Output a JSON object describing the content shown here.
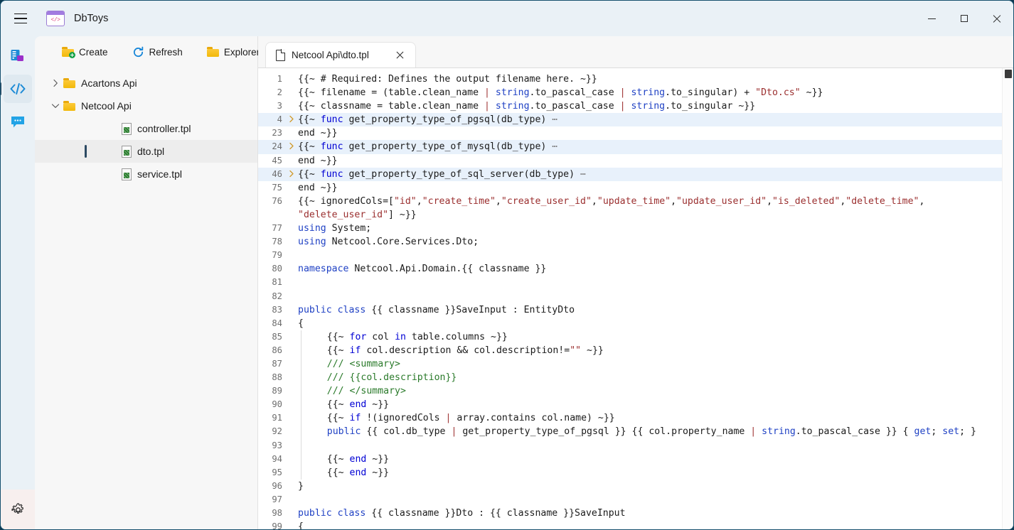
{
  "window": {
    "title": "DbToys",
    "logo_icon": "code-brackets-logo",
    "menu_icon": "hamburger-icon",
    "controls": {
      "minimize": "minimize-icon",
      "maximize": "maximize-icon",
      "close": "close-icon"
    }
  },
  "activity_bar": {
    "items": [
      {
        "name": "database-icon",
        "label": "Database",
        "active": false
      },
      {
        "name": "code-icon",
        "label": "Templates",
        "active": true
      },
      {
        "name": "chat-icon",
        "label": "Chat",
        "active": false
      }
    ],
    "settings": {
      "name": "gear-icon",
      "label": "Settings"
    }
  },
  "explorer": {
    "toolbar": [
      {
        "label": "Create",
        "icon": "new-folder-icon"
      },
      {
        "label": "Refresh",
        "icon": "refresh-icon"
      },
      {
        "label": "Explorer",
        "icon": "folder-icon"
      }
    ],
    "tree": [
      {
        "label": "Acartons Api",
        "type": "folder",
        "expanded": false,
        "depth": 0,
        "selected": false
      },
      {
        "label": "Netcool Api",
        "type": "folder",
        "expanded": true,
        "depth": 0,
        "selected": false
      },
      {
        "label": "controller.tpl",
        "type": "file",
        "depth": 1,
        "selected": false
      },
      {
        "label": "dto.tpl",
        "type": "file",
        "depth": 1,
        "selected": true
      },
      {
        "label": "service.tpl",
        "type": "file",
        "depth": 1,
        "selected": false
      }
    ]
  },
  "editor": {
    "tabs": [
      {
        "label": "Netcool Api\\dto.tpl",
        "icon": "file-icon",
        "close_icon": "close-icon",
        "active": true
      }
    ],
    "lines": [
      {
        "num": "1",
        "fold": "",
        "hl": false,
        "guide": false,
        "tokens": [
          {
            "t": "{{~ # Required: Defines the output filename here. ~}}",
            "c": "plain"
          }
        ]
      },
      {
        "num": "2",
        "fold": "",
        "hl": false,
        "guide": false,
        "tokens": [
          {
            "t": "{{~ filename = (table.clean_name ",
            "c": "plain"
          },
          {
            "t": "| ",
            "c": "pipe"
          },
          {
            "t": "string",
            "c": "kw2"
          },
          {
            "t": ".to_pascal_case ",
            "c": "plain"
          },
          {
            "t": "| ",
            "c": "pipe"
          },
          {
            "t": "string",
            "c": "kw2"
          },
          {
            "t": ".to_singular) + ",
            "c": "plain"
          },
          {
            "t": "\"Dto.cs\"",
            "c": "str"
          },
          {
            "t": " ~}}",
            "c": "plain"
          }
        ]
      },
      {
        "num": "3",
        "fold": "",
        "hl": false,
        "guide": false,
        "tokens": [
          {
            "t": "{{~ classname = table.clean_name ",
            "c": "plain"
          },
          {
            "t": "| ",
            "c": "pipe"
          },
          {
            "t": "string",
            "c": "kw2"
          },
          {
            "t": ".to_pascal_case ",
            "c": "plain"
          },
          {
            "t": "| ",
            "c": "pipe"
          },
          {
            "t": "string",
            "c": "kw2"
          },
          {
            "t": ".to_singular ~}}",
            "c": "plain"
          }
        ]
      },
      {
        "num": "4",
        "fold": ">",
        "hl": true,
        "guide": false,
        "tokens": [
          {
            "t": "{{~ ",
            "c": "plain"
          },
          {
            "t": "func",
            "c": "kw"
          },
          {
            "t": " get_property_type_of_pgsql(db_type)",
            "c": "plain"
          },
          {
            "t": " ⋯",
            "c": "ell"
          }
        ]
      },
      {
        "num": "23",
        "fold": "",
        "hl": false,
        "guide": false,
        "tokens": [
          {
            "t": "end ~}}",
            "c": "plain"
          }
        ]
      },
      {
        "num": "24",
        "fold": ">",
        "hl": true,
        "guide": false,
        "tokens": [
          {
            "t": "{{~ ",
            "c": "plain"
          },
          {
            "t": "func",
            "c": "kw"
          },
          {
            "t": " get_property_type_of_mysql(db_type)",
            "c": "plain"
          },
          {
            "t": " ⋯",
            "c": "ell"
          }
        ]
      },
      {
        "num": "45",
        "fold": "",
        "hl": false,
        "guide": false,
        "tokens": [
          {
            "t": "end ~}}",
            "c": "plain"
          }
        ]
      },
      {
        "num": "46",
        "fold": ">",
        "hl": true,
        "guide": false,
        "tokens": [
          {
            "t": "{{~ ",
            "c": "plain"
          },
          {
            "t": "func",
            "c": "kw"
          },
          {
            "t": " get_property_type_of_sql_server(db_type)",
            "c": "plain"
          },
          {
            "t": " ⋯",
            "c": "ell"
          }
        ]
      },
      {
        "num": "75",
        "fold": "",
        "hl": false,
        "guide": false,
        "tokens": [
          {
            "t": "end ~}}",
            "c": "plain"
          }
        ]
      },
      {
        "num": "76",
        "fold": "",
        "hl": false,
        "guide": false,
        "tokens": [
          {
            "t": "{{~ ignoredCols=[",
            "c": "plain"
          },
          {
            "t": "\"id\"",
            "c": "str"
          },
          {
            "t": ",",
            "c": "plain"
          },
          {
            "t": "\"create_time\"",
            "c": "str"
          },
          {
            "t": ",",
            "c": "plain"
          },
          {
            "t": "\"create_user_id\"",
            "c": "str"
          },
          {
            "t": ",",
            "c": "plain"
          },
          {
            "t": "\"update_time\"",
            "c": "str"
          },
          {
            "t": ",",
            "c": "plain"
          },
          {
            "t": "\"update_user_id\"",
            "c": "str"
          },
          {
            "t": ",",
            "c": "plain"
          },
          {
            "t": "\"is_deleted\"",
            "c": "str"
          },
          {
            "t": ",",
            "c": "plain"
          },
          {
            "t": "\"delete_time\"",
            "c": "str"
          },
          {
            "t": ",\n",
            "c": "plain"
          },
          {
            "t": "\"delete_user_id\"",
            "c": "str"
          },
          {
            "t": "] ~}}",
            "c": "plain"
          }
        ]
      },
      {
        "num": "77",
        "fold": "",
        "hl": false,
        "guide": false,
        "tokens": [
          {
            "t": "using",
            "c": "kw2"
          },
          {
            "t": " System;",
            "c": "plain"
          }
        ]
      },
      {
        "num": "78",
        "fold": "",
        "hl": false,
        "guide": false,
        "tokens": [
          {
            "t": "using",
            "c": "kw2"
          },
          {
            "t": " Netcool.Core.Services.Dto;",
            "c": "plain"
          }
        ]
      },
      {
        "num": "79",
        "fold": "",
        "hl": false,
        "guide": false,
        "tokens": []
      },
      {
        "num": "80",
        "fold": "",
        "hl": false,
        "guide": false,
        "tokens": [
          {
            "t": "namespace",
            "c": "kw2"
          },
          {
            "t": " Netcool.Api.Domain.{{ classname }}",
            "c": "plain"
          }
        ]
      },
      {
        "num": "81",
        "fold": "",
        "hl": false,
        "guide": false,
        "tokens": []
      },
      {
        "num": "82",
        "fold": "",
        "hl": false,
        "guide": false,
        "tokens": []
      },
      {
        "num": "83",
        "fold": "",
        "hl": false,
        "guide": false,
        "tokens": [
          {
            "t": "public",
            "c": "kw2"
          },
          {
            "t": " ",
            "c": "plain"
          },
          {
            "t": "class",
            "c": "kw2"
          },
          {
            "t": " {{ classname }}SaveInput : EntityDto",
            "c": "plain"
          }
        ]
      },
      {
        "num": "84",
        "fold": "",
        "hl": false,
        "guide": false,
        "tokens": [
          {
            "t": "{",
            "c": "plain"
          }
        ]
      },
      {
        "num": "85",
        "fold": "",
        "hl": false,
        "guide": true,
        "tokens": [
          {
            "t": "    {{~ ",
            "c": "plain"
          },
          {
            "t": "for",
            "c": "kw"
          },
          {
            "t": " col ",
            "c": "plain"
          },
          {
            "t": "in",
            "c": "kw"
          },
          {
            "t": " table.columns ~}}",
            "c": "plain"
          }
        ]
      },
      {
        "num": "86",
        "fold": "",
        "hl": false,
        "guide": true,
        "tokens": [
          {
            "t": "    {{~ ",
            "c": "plain"
          },
          {
            "t": "if",
            "c": "kw"
          },
          {
            "t": " col.description && col.description!=",
            "c": "plain"
          },
          {
            "t": "\"\"",
            "c": "str"
          },
          {
            "t": " ~}}",
            "c": "plain"
          }
        ]
      },
      {
        "num": "87",
        "fold": "",
        "hl": false,
        "guide": true,
        "tokens": [
          {
            "t": "    /// <summary>",
            "c": "cmt"
          }
        ]
      },
      {
        "num": "88",
        "fold": "",
        "hl": false,
        "guide": true,
        "tokens": [
          {
            "t": "    /// {{col.description}}",
            "c": "cmt"
          }
        ]
      },
      {
        "num": "89",
        "fold": "",
        "hl": false,
        "guide": true,
        "tokens": [
          {
            "t": "    /// </summary>",
            "c": "cmt"
          }
        ]
      },
      {
        "num": "90",
        "fold": "",
        "hl": false,
        "guide": true,
        "tokens": [
          {
            "t": "    {{~ ",
            "c": "plain"
          },
          {
            "t": "end",
            "c": "kw"
          },
          {
            "t": " ~}}",
            "c": "plain"
          }
        ]
      },
      {
        "num": "91",
        "fold": "",
        "hl": false,
        "guide": true,
        "tokens": [
          {
            "t": "    {{~ ",
            "c": "plain"
          },
          {
            "t": "if",
            "c": "kw"
          },
          {
            "t": " !(ignoredCols ",
            "c": "plain"
          },
          {
            "t": "| ",
            "c": "pipe"
          },
          {
            "t": "array",
            "c": "plain"
          },
          {
            "t": ".contains col.name) ~}}",
            "c": "plain"
          }
        ]
      },
      {
        "num": "92",
        "fold": "",
        "hl": false,
        "guide": true,
        "tokens": [
          {
            "t": "    ",
            "c": "plain"
          },
          {
            "t": "public",
            "c": "kw2"
          },
          {
            "t": " {{ col.db_type ",
            "c": "plain"
          },
          {
            "t": "| ",
            "c": "pipe"
          },
          {
            "t": "get_property_type_of_pgsql }} {{ col.property_name ",
            "c": "plain"
          },
          {
            "t": "| ",
            "c": "pipe"
          },
          {
            "t": "string",
            "c": "kw2"
          },
          {
            "t": ".to_pascal_case }} { ",
            "c": "plain"
          },
          {
            "t": "get",
            "c": "kw2"
          },
          {
            "t": "; ",
            "c": "plain"
          },
          {
            "t": "set",
            "c": "kw2"
          },
          {
            "t": "; }",
            "c": "plain"
          }
        ]
      },
      {
        "num": "93",
        "fold": "",
        "hl": false,
        "guide": true,
        "tokens": []
      },
      {
        "num": "94",
        "fold": "",
        "hl": false,
        "guide": true,
        "tokens": [
          {
            "t": "    {{~ ",
            "c": "plain"
          },
          {
            "t": "end",
            "c": "kw"
          },
          {
            "t": " ~}}",
            "c": "plain"
          }
        ]
      },
      {
        "num": "95",
        "fold": "",
        "hl": false,
        "guide": true,
        "tokens": [
          {
            "t": "    {{~ ",
            "c": "plain"
          },
          {
            "t": "end",
            "c": "kw"
          },
          {
            "t": " ~}}",
            "c": "plain"
          }
        ]
      },
      {
        "num": "96",
        "fold": "",
        "hl": false,
        "guide": false,
        "tokens": [
          {
            "t": "}",
            "c": "plain"
          }
        ]
      },
      {
        "num": "97",
        "fold": "",
        "hl": false,
        "guide": false,
        "tokens": []
      },
      {
        "num": "98",
        "fold": "",
        "hl": false,
        "guide": false,
        "tokens": [
          {
            "t": "public",
            "c": "kw2"
          },
          {
            "t": " ",
            "c": "plain"
          },
          {
            "t": "class",
            "c": "kw2"
          },
          {
            "t": " {{ classname }}Dto : {{ classname }}SaveInput",
            "c": "plain"
          }
        ]
      },
      {
        "num": "99",
        "fold": "",
        "hl": false,
        "guide": false,
        "tokens": [
          {
            "t": "{",
            "c": "plain"
          }
        ]
      }
    ],
    "scrollbar": {
      "name": "vertical-scrollbar",
      "thumb_top_pct": 0,
      "thumb_height_pct": 2
    }
  }
}
